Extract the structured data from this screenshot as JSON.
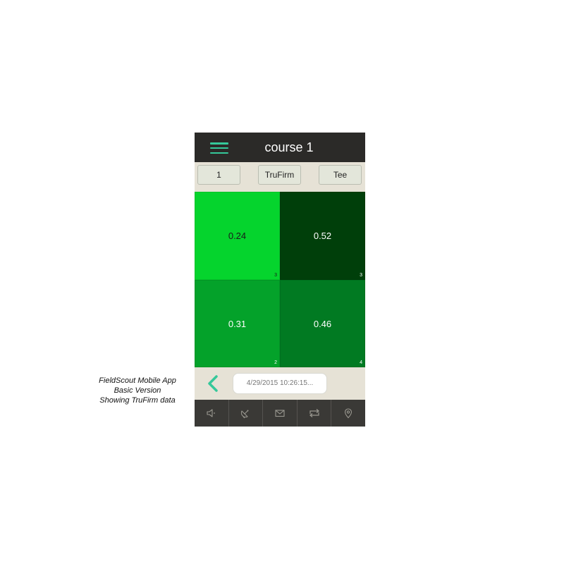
{
  "app": {
    "title": "course 1"
  },
  "selectors": [
    {
      "label": "1"
    },
    {
      "label": "TruFirm"
    },
    {
      "label": "Tee"
    }
  ],
  "grid": {
    "cells": [
      {
        "value": "0.24",
        "count": "3",
        "color": "#05d42d",
        "text_color": "#1a1a1a"
      },
      {
        "value": "0.52",
        "count": "3",
        "color": "#003f0a",
        "text_color": "#ffffff"
      },
      {
        "value": "0.31",
        "count": "2",
        "color": "#04a22a",
        "text_color": "#ffffff"
      },
      {
        "value": "0.46",
        "count": "4",
        "color": "#017a22",
        "text_color": "#ffffff"
      }
    ]
  },
  "footer": {
    "timestamp": "4/29/2015 10:26:15..."
  },
  "tabs": [
    {
      "icon": "speaker-icon"
    },
    {
      "icon": "satellite-dish-icon"
    },
    {
      "icon": "mail-icon"
    },
    {
      "icon": "sync-arrows-icon"
    },
    {
      "icon": "map-pin-icon"
    }
  ],
  "caption": {
    "line1": "FieldScout Mobile App",
    "line2": "Basic Version",
    "line3": "Showing TruFirm data"
  },
  "colors": {
    "accent": "#35c89a",
    "header_bg": "#2b2a28",
    "bar_bg": "#e6e2d6",
    "tabbar_bg": "#3a3936"
  }
}
